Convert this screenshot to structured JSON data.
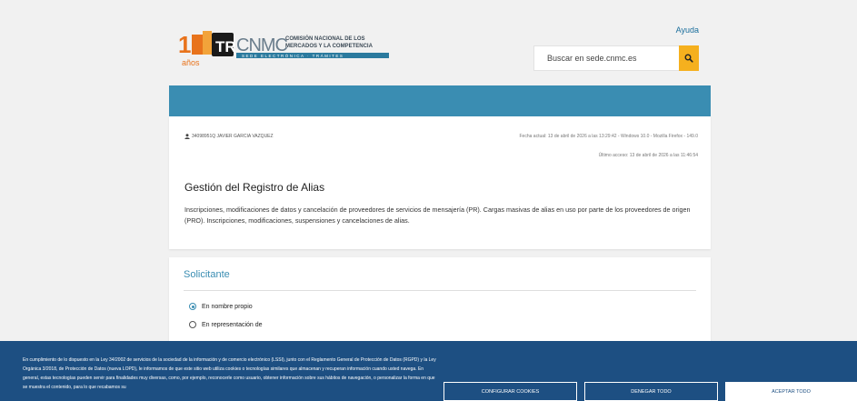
{
  "header": {
    "logo_lines": [
      "COMISIÓN NACIONAL DE LOS",
      "MERCADOS Y LA COMPETENCIA"
    ],
    "logo_strip": "SEDE ELECTRÓNICA · TRÁMITES",
    "anniversary": "años",
    "help_link": "Ayuda",
    "search_placeholder": "Buscar en sede.cnmc.es"
  },
  "user_bar": {
    "user": "34098951Q JAVIER GARCIA VAZQUEZ",
    "fecha": "Fecha actual: 13 de abril de 2026 a las 13:29:42 - Windows 10.0 - Mozilla Firefox - 149.0",
    "ultimo": "Último acceso: 13 de abril de 2026 a las 11:46:54"
  },
  "main": {
    "title": "Gestión del Registro de Alias",
    "description": "Inscripciones, modificaciones de datos y cancelación de proveedores de servicios de mensajería (PR). Cargas masivas de alias en uso por parte de los proveedores de origen (PRO). Inscripciones, modificaciones, suspensiones y cancelaciones de alias."
  },
  "solicitante": {
    "title": "Solicitante",
    "options": [
      {
        "label": "En nombre propio",
        "selected": true
      },
      {
        "label": "En representación de",
        "selected": false
      }
    ]
  },
  "cookies": {
    "text": "En cumplimiento de lo dispuesto en la Ley 34/2002 de servicios de la sociedad de la información y de comercio electrónico (LSSI), junto con el Reglamento General de Protección de Datos (RGPD) y la Ley Orgánica 3/2018, de Protección de Datos (nueva LOPD), le informamos de que este sitio web utiliza cookies o tecnologías similares que almacenan y recuperan información cuando usted navega. En general, estas tecnologías pueden servir para finalidades muy diversas, como, por ejemplo, reconocerle como usuario, obtener información sobre sus hábitos de navegación, o personalizar la forma en que se muestra el contenido, para lo que recabamos su",
    "configure": "CONFIGURAR COOKIES",
    "deny": "DENEGAR TODO",
    "accept": "ACEPTAR TODO"
  },
  "colors": {
    "accent": "#3a8db2",
    "search_button": "#f5b01e",
    "cookie_bg": "#1d4f82"
  }
}
